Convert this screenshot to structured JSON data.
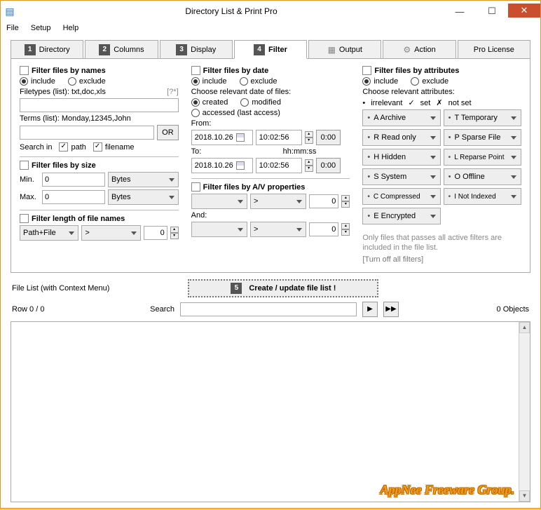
{
  "window": {
    "title": "Directory List & Print Pro"
  },
  "menu": {
    "file": "File",
    "setup": "Setup",
    "help": "Help"
  },
  "tabs": [
    {
      "num": "1",
      "label": "Directory"
    },
    {
      "num": "2",
      "label": "Columns"
    },
    {
      "num": "3",
      "label": "Display"
    },
    {
      "num": "4",
      "label": "Filter"
    },
    {
      "icon": "output",
      "label": "Output"
    },
    {
      "icon": "action",
      "label": "Action"
    },
    {
      "label": "Pro License"
    }
  ],
  "names": {
    "title": "Filter files by names",
    "include": "include",
    "exclude": "exclude",
    "filetypes_label": "Filetypes (list): txt,doc,xls",
    "filetypes_hint": "[?*]",
    "terms_label": "Terms (list): Monday,12345,John",
    "or": "OR",
    "searchin": "Search in",
    "path": "path",
    "filename": "filename"
  },
  "size": {
    "title": "Filter files by size",
    "min": "Min.",
    "max": "Max.",
    "val0": "0",
    "unit": "Bytes"
  },
  "length": {
    "title": "Filter length of file names",
    "combo": "Path+File",
    "op": "> ",
    "val": "0"
  },
  "date": {
    "title": "Filter files by date",
    "include": "include",
    "exclude": "exclude",
    "choose": "Choose relevant date of files:",
    "created": "created",
    "modified": "modified",
    "accessed": "accessed (last access)",
    "from": "From:",
    "to": "To:",
    "hhmmss": "hh:mm:ss",
    "d1": "2018.10.26",
    "t1": "10:02:56",
    "zero": "0:00",
    "d2": "2018.10.26",
    "t2": "10:02:56"
  },
  "av": {
    "title": "Filter files by A/V properties",
    "and": "And:",
    "op": "> ",
    "val": "0"
  },
  "attr": {
    "title": "Filter files by attributes",
    "include": "include",
    "exclude": "exclude",
    "choose": "Choose relevant attributes:",
    "legend_irr": "irrelevant",
    "legend_set": "set",
    "legend_not": "not set",
    "a": "A Archive",
    "t": "T Temporary",
    "r": "R Read only",
    "p": "P Sparse File",
    "h": "H Hidden",
    "l": "L Reparse Point",
    "s": "S System",
    "o": "O Offline",
    "c": "C Compressed",
    "i": "I  Not Indexed",
    "e": "E Encrypted",
    "hint": "Only files that passes all active filters are included in the file list.",
    "turnoff": "[Turn off all filters]"
  },
  "bottom": {
    "filelist": "File List (with Context Menu)",
    "create_num": "5",
    "create": "Create / update file list !",
    "row": "Row 0 / 0",
    "search": "Search",
    "objects": "0 Objects",
    "watermark": "AppNee Freeware Group."
  }
}
